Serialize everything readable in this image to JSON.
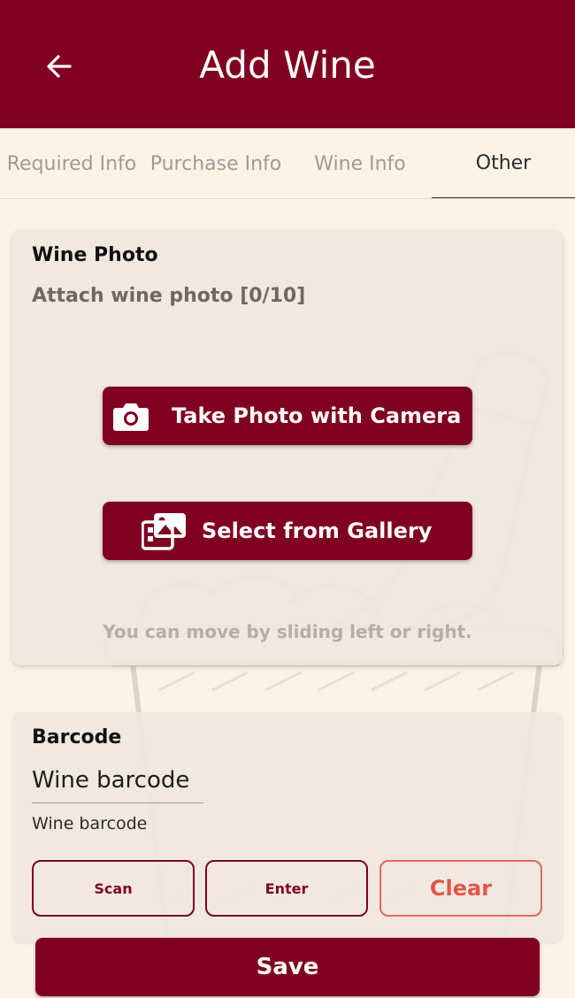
{
  "header": {
    "title": "Add Wine",
    "back_icon": "arrow-left-icon",
    "background_color": "#7f0020"
  },
  "tabs": [
    {
      "label": "Required Info",
      "active": false
    },
    {
      "label": "Purchase Info",
      "active": false
    },
    {
      "label": "Wine Info",
      "active": false
    },
    {
      "label": "Other",
      "active": true
    }
  ],
  "photo_section": {
    "title": "Wine Photo",
    "subtitle": "Attach wine photo [0/10]",
    "camera_button": {
      "label": "Take Photo with Camera",
      "icon": "camera-icon"
    },
    "gallery_button": {
      "label": "Select from Gallery",
      "icon": "gallery-icon"
    },
    "hint": "You can move by sliding left or right."
  },
  "barcode_section": {
    "title": "Barcode",
    "value": "Wine barcode",
    "label": "Wine barcode",
    "scan_label": "Scan",
    "enter_label": "Enter",
    "clear_label": "Clear"
  },
  "save_label": "Save",
  "colors": {
    "primary": "#7f0020",
    "background": "#fcf3e7",
    "clear_accent": "#e0564c"
  }
}
